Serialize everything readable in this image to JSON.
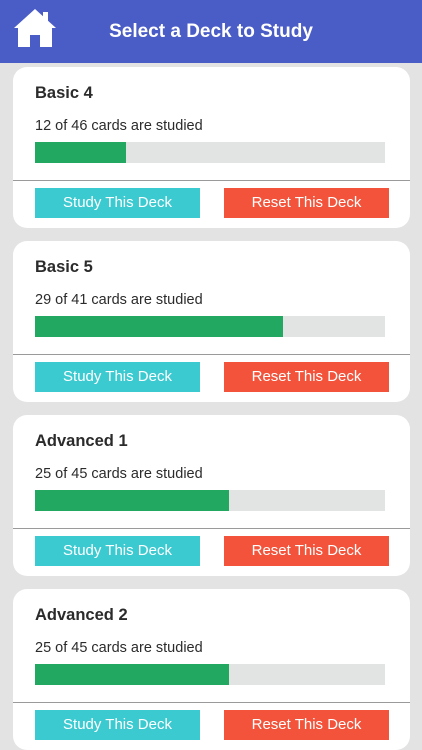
{
  "header": {
    "title": "Select a Deck to Study",
    "home_icon": "home-icon",
    "background_color": "#4a5cc6"
  },
  "colors": {
    "progress_fill": "#22a861",
    "progress_track": "#e2e4e3",
    "study_button": "#3ccad1",
    "reset_button": "#f3533a"
  },
  "decks": [
    {
      "name": "Basic 4",
      "status": "12 of 46 cards are studied",
      "studied": 12,
      "total": 46,
      "study_label": "Study This Deck",
      "reset_label": "Reset This Deck"
    },
    {
      "name": "Basic 5",
      "status": "29 of 41 cards are studied",
      "studied": 29,
      "total": 41,
      "study_label": "Study This Deck",
      "reset_label": "Reset This Deck"
    },
    {
      "name": "Advanced 1",
      "status": "25 of 45 cards are studied",
      "studied": 25,
      "total": 45,
      "study_label": "Study This Deck",
      "reset_label": "Reset This Deck"
    },
    {
      "name": "Advanced 2",
      "status": "25 of 45 cards are studied",
      "studied": 25,
      "total": 45,
      "study_label": "Study This Deck",
      "reset_label": "Reset This Deck"
    }
  ]
}
